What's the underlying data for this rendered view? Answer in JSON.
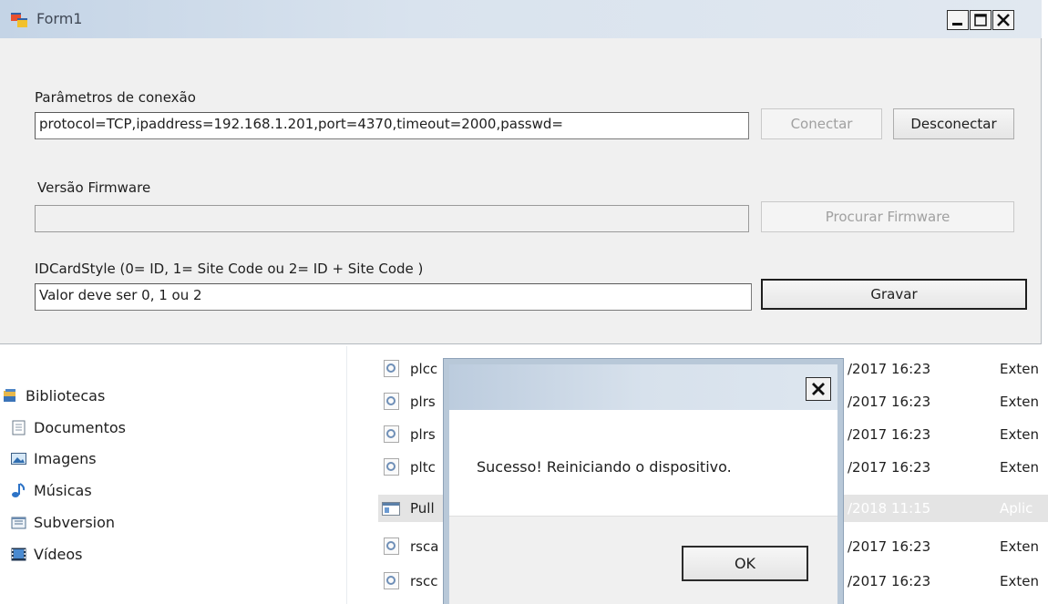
{
  "form": {
    "title": "Form1",
    "connection_label": "Parâmetros de conexão",
    "connection_value": "protocol=TCP,ipaddress=192.168.1.201,port=4370,timeout=2000,passwd=",
    "connect_button": "Conectar",
    "disconnect_button": "Desconectar",
    "firmware_label": "Versão Firmware",
    "firmware_value": "",
    "search_firmware_button": "Procurar Firmware",
    "idcard_label": "IDCardStyle (0= ID, 1= Site Code ou 2= ID + Site Code )",
    "idcard_value": "Valor deve ser 0, 1 ou 2",
    "save_button": "Gravar"
  },
  "explorer": {
    "nav_items": [
      {
        "label": "Bibliotecas",
        "icon": "libraries-icon"
      },
      {
        "label": "Documentos",
        "icon": "documents-icon"
      },
      {
        "label": "Imagens",
        "icon": "images-icon"
      },
      {
        "label": "Músicas",
        "icon": "music-icon"
      },
      {
        "label": "Subversion",
        "icon": "subversion-icon"
      },
      {
        "label": "Vídeos",
        "icon": "videos-icon"
      }
    ],
    "files": [
      {
        "name": "plcc",
        "date": "/2017 16:23",
        "type": "Exten"
      },
      {
        "name": "plrs",
        "date": "/2017 16:23",
        "type": "Exten"
      },
      {
        "name": "plrs",
        "date": "/2017 16:23",
        "type": "Exten"
      },
      {
        "name": "pltc",
        "date": "/2017 16:23",
        "type": "Exten"
      },
      {
        "name": "Pull",
        "date": "/2018 11:15",
        "type": "Aplic"
      },
      {
        "name": "rsca",
        "date": "/2017 16:23",
        "type": "Exten"
      },
      {
        "name": "rscc",
        "date": "/2017 16:23",
        "type": "Exten"
      }
    ]
  },
  "dialog": {
    "message": "Sucesso! Reiniciando o dispositivo.",
    "ok_button": "OK"
  }
}
